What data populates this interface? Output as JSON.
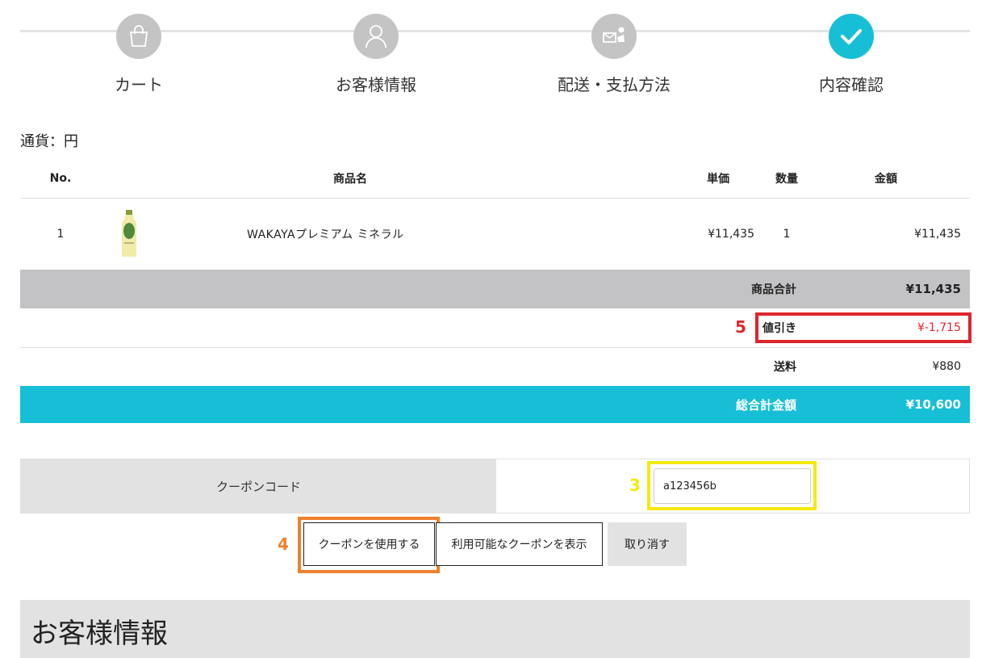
{
  "stepper": {
    "steps": [
      {
        "label": "カート",
        "icon": "shopping-bag-icon",
        "active": false
      },
      {
        "label": "お客様情報",
        "icon": "user-icon",
        "active": false
      },
      {
        "label": "配送・支払方法",
        "icon": "delivery-icon",
        "active": false
      },
      {
        "label": "内容確認",
        "icon": "check-icon",
        "active": true
      }
    ]
  },
  "currency_label": "通貨：円",
  "table": {
    "headers": {
      "no": "No.",
      "name": "商品名",
      "price": "単価",
      "qty": "数量",
      "amount": "金額"
    },
    "items": [
      {
        "no": "1",
        "name": "WAKAYAプレミアム ミネラル",
        "price": "¥11,435",
        "qty": "1",
        "amount": "¥11,435"
      }
    ],
    "subtotal": {
      "label": "商品合計",
      "value": "¥11,435"
    },
    "discount": {
      "label": "値引き",
      "value": "¥-1,715"
    },
    "shipping": {
      "label": "送料",
      "value": "¥880"
    },
    "total": {
      "label": "総合計金額",
      "value": "¥10,600"
    }
  },
  "coupon": {
    "label": "クーポンコード",
    "value": "a123456b",
    "apply_button": "クーポンを使用する",
    "show_button": "利用可能なクーポンを表示",
    "cancel_button": "取り消す"
  },
  "annotations": {
    "discount_marker": "5",
    "input_marker": "3",
    "apply_marker": "4"
  },
  "section_title": "お客様情報",
  "colors": {
    "accent": "#17bfd6",
    "step_inactive": "#c4c4c4",
    "discount_red": "#e0242b",
    "marker_yellow": "#f5ea0b",
    "marker_orange": "#f0802c"
  }
}
